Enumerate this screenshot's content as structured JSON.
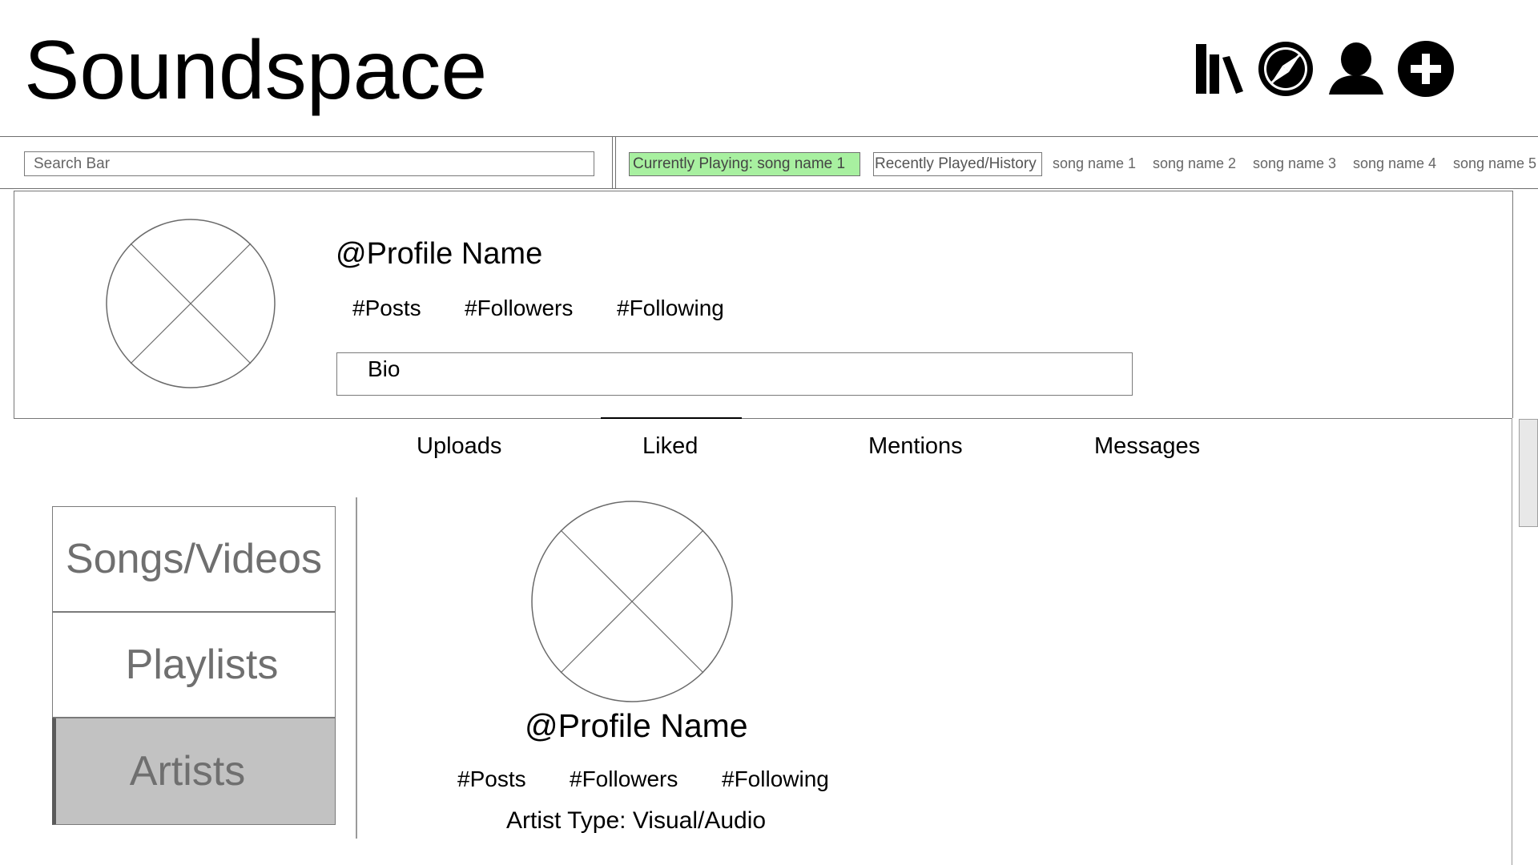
{
  "app": {
    "title": "Soundspace"
  },
  "top_icons": [
    {
      "name": "library-icon"
    },
    {
      "name": "explore-compass-icon"
    },
    {
      "name": "profile-icon"
    },
    {
      "name": "add-icon"
    }
  ],
  "search": {
    "placeholder": "Search Bar"
  },
  "player": {
    "currently_playing": "Currently Playing: song name 1",
    "history_label": "Recently Played/History",
    "recent_songs": [
      "song name 1",
      "song name 2",
      "song name 3",
      "song name 4",
      "song name 5"
    ]
  },
  "profile": {
    "name": "@Profile Name",
    "posts": "#Posts",
    "followers": "#Followers",
    "following": "#Following",
    "bio": "Bio"
  },
  "tabs": [
    "Uploads",
    "Liked",
    "Mentions",
    "Messages"
  ],
  "active_tab": "Liked",
  "categories": [
    "Songs/Videos",
    "Playlists",
    "Artists"
  ],
  "active_category": "Artists",
  "artist_card": {
    "name": "@Profile Name",
    "posts": "#Posts",
    "followers": "#Followers",
    "following": "#Following",
    "artist_type": "Artist Type: Visual/Audio"
  },
  "colors": {
    "now_playing_bg": "#a8f0a0",
    "active_category_bg": "#c2c2c2",
    "border": "#777777"
  }
}
